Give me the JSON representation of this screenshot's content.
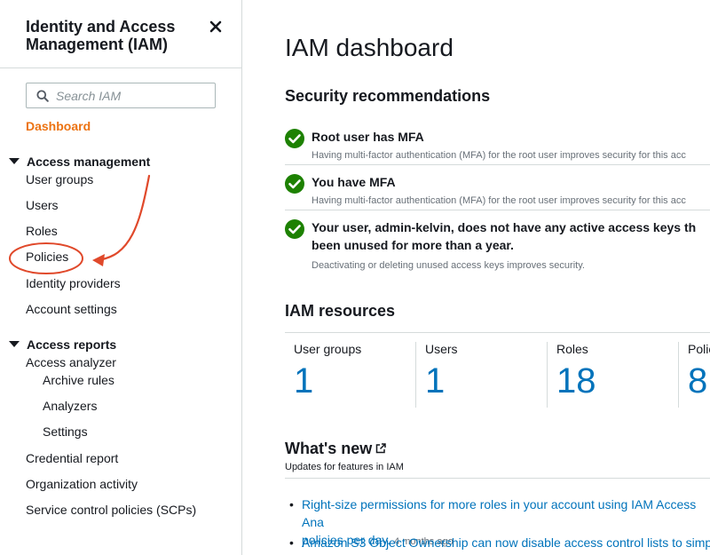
{
  "sidebar": {
    "title": "Identity and Access Management (IAM)",
    "search_placeholder": "Search IAM",
    "dashboard": "Dashboard",
    "access_management": {
      "label": "Access management",
      "items": [
        "User groups",
        "Users",
        "Roles",
        "Policies",
        "Identity providers",
        "Account settings"
      ]
    },
    "access_reports": {
      "label": "Access reports",
      "analyzer": "Access analyzer",
      "analyzer_items": [
        "Archive rules",
        "Analyzers",
        "Settings"
      ],
      "items": [
        "Credential report",
        "Organization activity",
        "Service control policies (SCPs)"
      ]
    }
  },
  "main": {
    "title": "IAM dashboard",
    "security": {
      "heading": "Security recommendations",
      "items": [
        {
          "title": "Root user has MFA",
          "desc": "Having multi-factor authentication (MFA) for the root user improves security for this acc"
        },
        {
          "title": "You have MFA",
          "desc": "Having multi-factor authentication (MFA) for the root user improves security for this acc"
        },
        {
          "title": "Your user, admin-kelvin, does not have any active access keys th",
          "title2": "been unused for more than a year.",
          "desc": "Deactivating or deleting unused access keys improves security."
        }
      ]
    },
    "resources": {
      "heading": "IAM resources",
      "items": [
        {
          "label": "User groups",
          "value": "1"
        },
        {
          "label": "Users",
          "value": "1"
        },
        {
          "label": "Roles",
          "value": "18"
        },
        {
          "label": "Polic",
          "value": "8"
        }
      ]
    },
    "whats_new": {
      "heading": "What's new",
      "subtitle": "Updates for features in IAM",
      "items": [
        {
          "text": "Right-size permissions for more roles in your account using IAM Access Ana",
          "text2": "policies per day.",
          "age": "4 months ago"
        },
        {
          "text": "Amazon S3 Object Ownership can now disable access control lists to simpl"
        }
      ]
    }
  },
  "colors": {
    "accent": "#ec7211",
    "link": "#0073bb",
    "success": "#1d8102",
    "annotation": "#e0492b"
  }
}
